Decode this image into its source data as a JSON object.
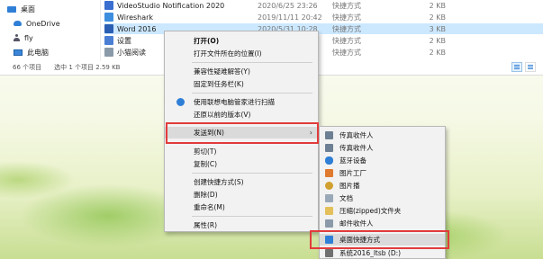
{
  "navigation": {
    "items": [
      {
        "label": "桌面",
        "icon": "desktop-icon"
      },
      {
        "label": "OneDrive",
        "icon": "onedrive-icon"
      },
      {
        "label": "fly",
        "icon": "user-icon"
      },
      {
        "label": "此电脑",
        "icon": "this-pc-icon"
      }
    ]
  },
  "files": [
    {
      "name": "VideoStudio Notification 2020",
      "date": "2020/6/25 23:26",
      "type": "快捷方式",
      "size": "2 KB",
      "icon_color": "#3a6fd0"
    },
    {
      "name": "Wireshark",
      "date": "2019/11/11 20:42",
      "type": "快捷方式",
      "size": "2 KB",
      "icon_color": "#3e8ee0"
    },
    {
      "name": "Word 2016",
      "date": "2020/5/31 10:28",
      "type": "快捷方式",
      "size": "3 KB",
      "icon_color": "#2b5fb4"
    },
    {
      "name": "设置",
      "date": "",
      "type": "快捷方式",
      "size": "2 KB",
      "icon_color": "#4a7fd4"
    },
    {
      "name": "小猫阅读",
      "date": "",
      "type": "快捷方式",
      "size": "2 KB",
      "icon_color": "#8a9aa8"
    }
  ],
  "status": {
    "count": "66 个项目",
    "selected": "选中 1 个项目  2.59 KB"
  },
  "context_menu": {
    "items": [
      {
        "label": "打开(O)",
        "bold": true
      },
      {
        "label": "打开文件所在的位置(I)"
      },
      {
        "label": "兼容性疑难解答(Y)"
      },
      {
        "label": "固定到任务栏(K)"
      },
      {
        "label": "使用联想电脑管家进行扫描",
        "icon": "lenovo-scan-icon"
      },
      {
        "label": "还原以前的版本(V)"
      },
      {
        "label": "发送到(N)",
        "submenu": true
      },
      {
        "label": "剪切(T)"
      },
      {
        "label": "复制(C)"
      },
      {
        "label": "创建快捷方式(S)"
      },
      {
        "label": "删除(D)"
      },
      {
        "label": "重命名(M)"
      },
      {
        "label": "属性(R)"
      }
    ]
  },
  "send_to_menu": {
    "items": [
      {
        "label": "传真收件人",
        "icon_color": "#6d7f92"
      },
      {
        "label": "传真收件人",
        "icon_color": "#6d7f92"
      },
      {
        "label": "蓝牙设备",
        "icon_color": "#2f7fd6"
      },
      {
        "label": "图片工厂",
        "icon_color": "#e07a2f"
      },
      {
        "label": "图片播",
        "icon_color": "#d0a030"
      },
      {
        "label": "文档",
        "icon_color": "#9aa9b8"
      },
      {
        "label": "压缩(zipped)文件夹",
        "icon_color": "#e3c05a"
      },
      {
        "label": "邮件收件人",
        "icon_color": "#8a9aa8"
      },
      {
        "label": "桌面快捷方式",
        "icon_color": "#2f7fd6"
      },
      {
        "label": "系统2016_ltsb (D:)",
        "icon_color": "#707070"
      }
    ]
  },
  "highlight_color": "#e23b3b"
}
